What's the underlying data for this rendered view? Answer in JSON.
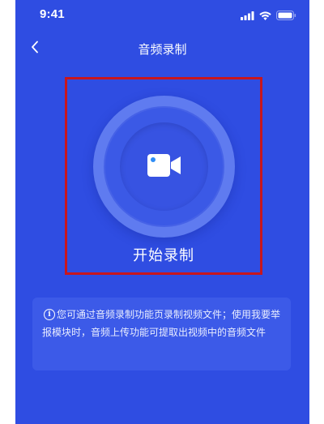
{
  "status_bar": {
    "time": "9:41"
  },
  "nav": {
    "title": "音频录制",
    "back_icon": "chevron-left-icon"
  },
  "record": {
    "start_label": "开始录制",
    "camera_icon": "video-camera-icon"
  },
  "info": {
    "icon": "info-icon",
    "text": "您可通过音频录制功能页录制视频文件；使用我要举报模块时，音频上传功能可提取出视频中的音频文件"
  },
  "colors": {
    "background": "#2f4de2",
    "highlight_border": "#c8161d",
    "camera_dot": "#2f8df5"
  }
}
